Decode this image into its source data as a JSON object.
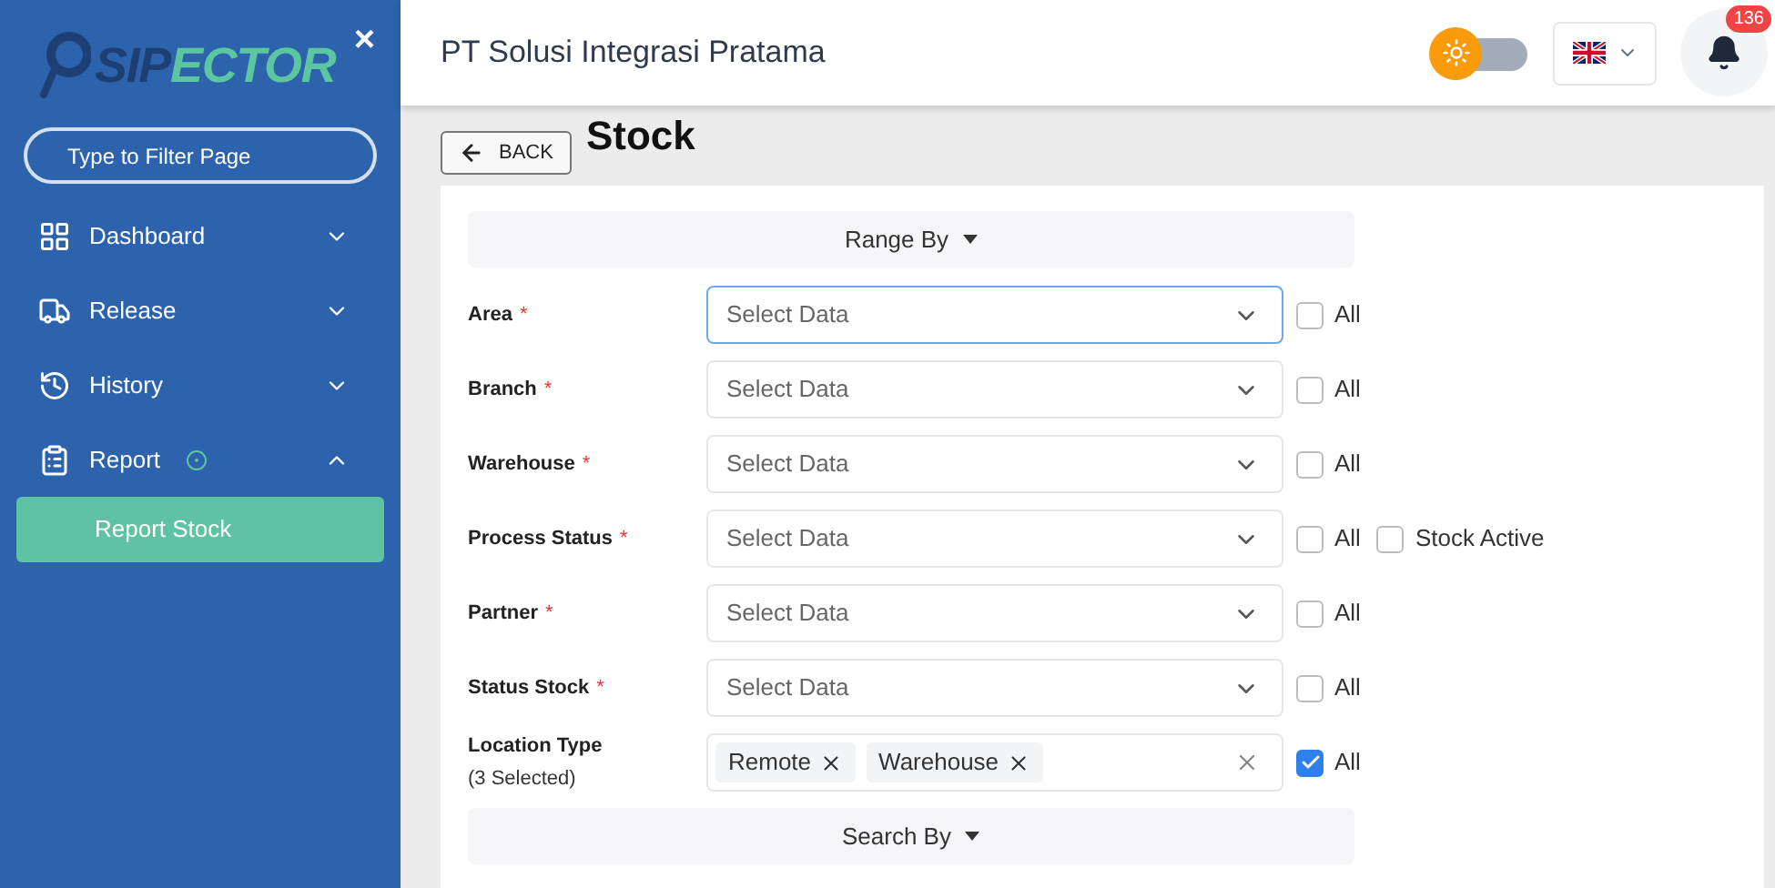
{
  "sidebar": {
    "logo": {
      "part_1": "SIP",
      "part_2": "ECTOR"
    },
    "close": "×",
    "filter": {
      "placeholder": "Type to Filter Page"
    },
    "items": [
      {
        "label": "Dashboard",
        "kind": "grid",
        "expanded": false,
        "active": false
      },
      {
        "label": "Release",
        "kind": "truck",
        "expanded": false,
        "active": false
      },
      {
        "label": "History",
        "kind": "history",
        "expanded": false,
        "active": false
      },
      {
        "label": "Report",
        "kind": "clipboard",
        "expanded": true,
        "active": true,
        "children": [
          {
            "label": "Report Stock",
            "selected": true
          }
        ]
      }
    ]
  },
  "header": {
    "company": "PT Solusi Integrasi Pratama",
    "theme_dark": false,
    "notifications": "136"
  },
  "page": {
    "title": "Stock",
    "back": "BACK",
    "range_by": "Range By",
    "search_by": "Search By",
    "fields": [
      {
        "label": "Area",
        "required_mark": "*",
        "placeholder": "Select Data",
        "focused": true,
        "all": "All",
        "all_checked": false
      },
      {
        "label": "Branch",
        "required_mark": "*",
        "placeholder": "Select Data",
        "focused": false,
        "all": "All",
        "all_checked": false
      },
      {
        "label": "Warehouse",
        "required_mark": "*",
        "placeholder": "Select Data",
        "focused": false,
        "all": "All",
        "all_checked": false
      },
      {
        "label": "Process Status",
        "required_mark": "*",
        "placeholder": "Select Data",
        "focused": false,
        "all": "All",
        "all_checked": false,
        "extra": {
          "label": "Stock Active",
          "checked": false
        }
      },
      {
        "label": "Partner",
        "required_mark": "*",
        "placeholder": "Select Data",
        "focused": false,
        "all": "All",
        "all_checked": false
      },
      {
        "label": "Status Stock",
        "required_mark": "*",
        "placeholder": "Select Data",
        "focused": false,
        "all": "All",
        "all_checked": false
      },
      {
        "label": "Location Type",
        "sublabel": "(3 Selected)",
        "tags": [
          "Remote",
          "Warehouse"
        ],
        "focused": false,
        "all": "All",
        "all_checked": true
      }
    ]
  }
}
